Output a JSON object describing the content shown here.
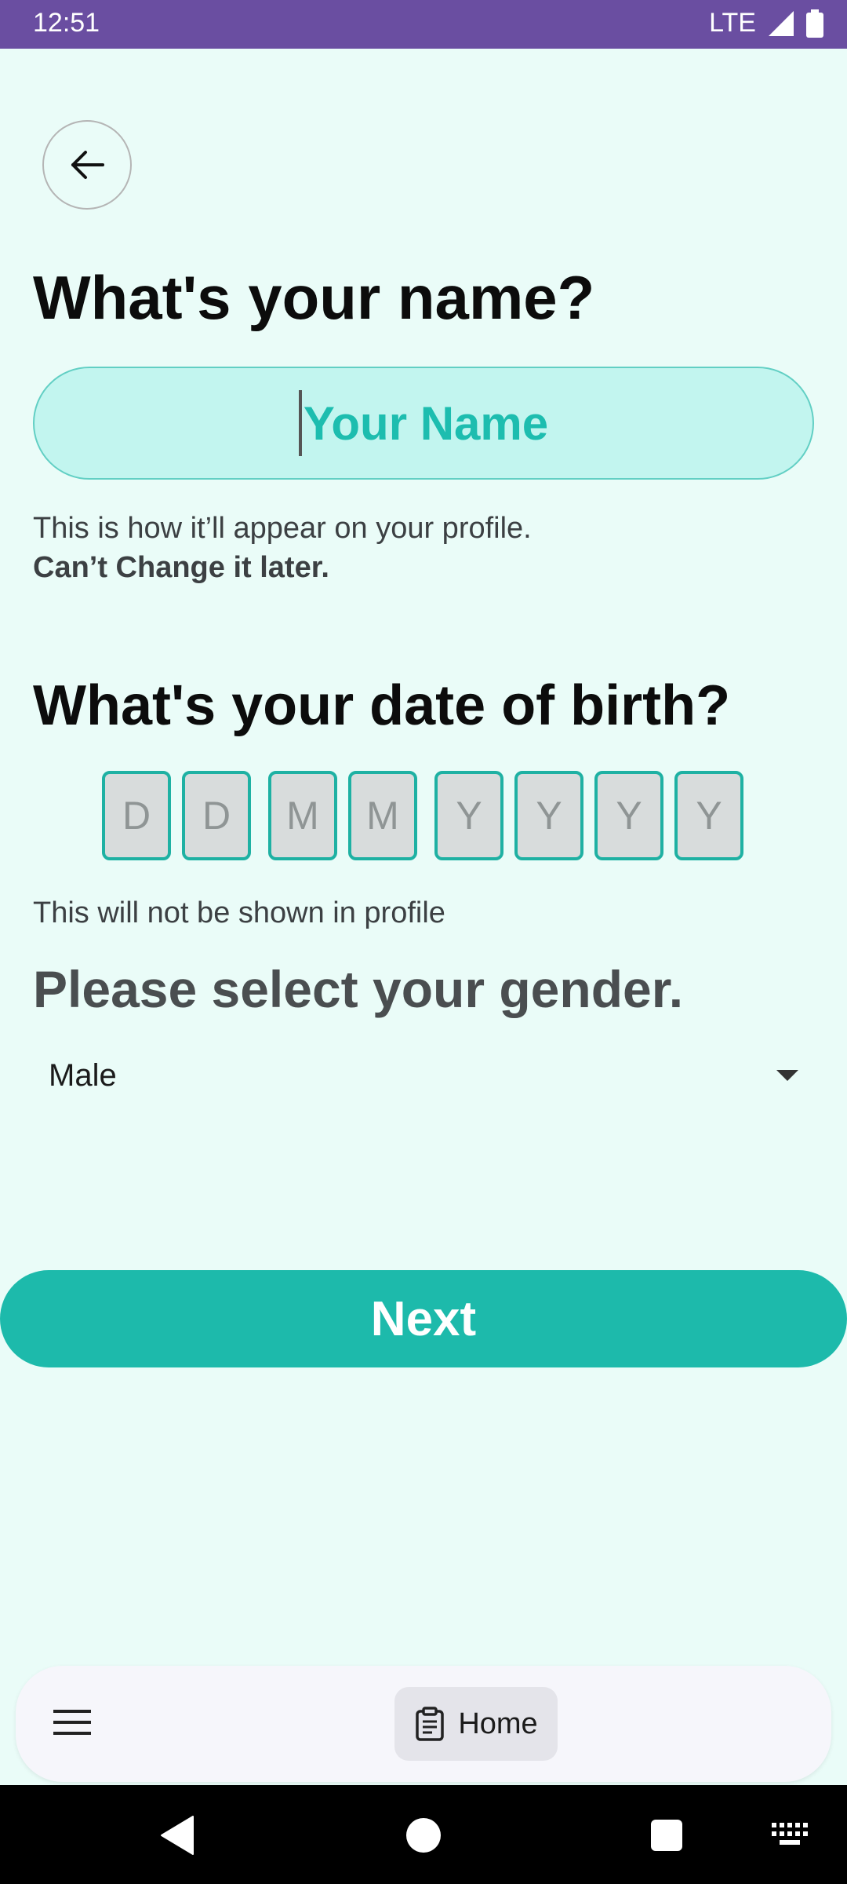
{
  "status_bar": {
    "time": "12:51",
    "network": "LTE",
    "color": "#6a4ea1"
  },
  "back_button": {
    "icon": "arrow-left-icon"
  },
  "name_section": {
    "title": "What's your name?",
    "placeholder": "Your Name",
    "value": "",
    "hint_line1": "This is how it’ll appear on your profile.",
    "hint_line2": "Can’t Change it later."
  },
  "dob_section": {
    "title": "What's your date of birth?",
    "boxes": [
      "D",
      "D",
      "M",
      "M",
      "Y",
      "Y",
      "Y",
      "Y"
    ],
    "hint": "This will not be shown in profile"
  },
  "gender_section": {
    "title": "Please select your gender.",
    "selected": "Male"
  },
  "next_button": {
    "label": "Next",
    "color": "#1dbaab"
  },
  "bottom_bar": {
    "menu_icon": "hamburger-menu-icon",
    "home_icon": "clipboard-icon",
    "home_label": "Home"
  },
  "nav_bar": {
    "back_icon": "nav-back-icon",
    "home_icon": "nav-home-icon",
    "recents_icon": "nav-recents-icon",
    "keyboard_icon": "keyboard-icon"
  },
  "colors": {
    "background": "#eafcf8",
    "accent": "#1dbaab",
    "field_fill": "#c2f5ef"
  }
}
